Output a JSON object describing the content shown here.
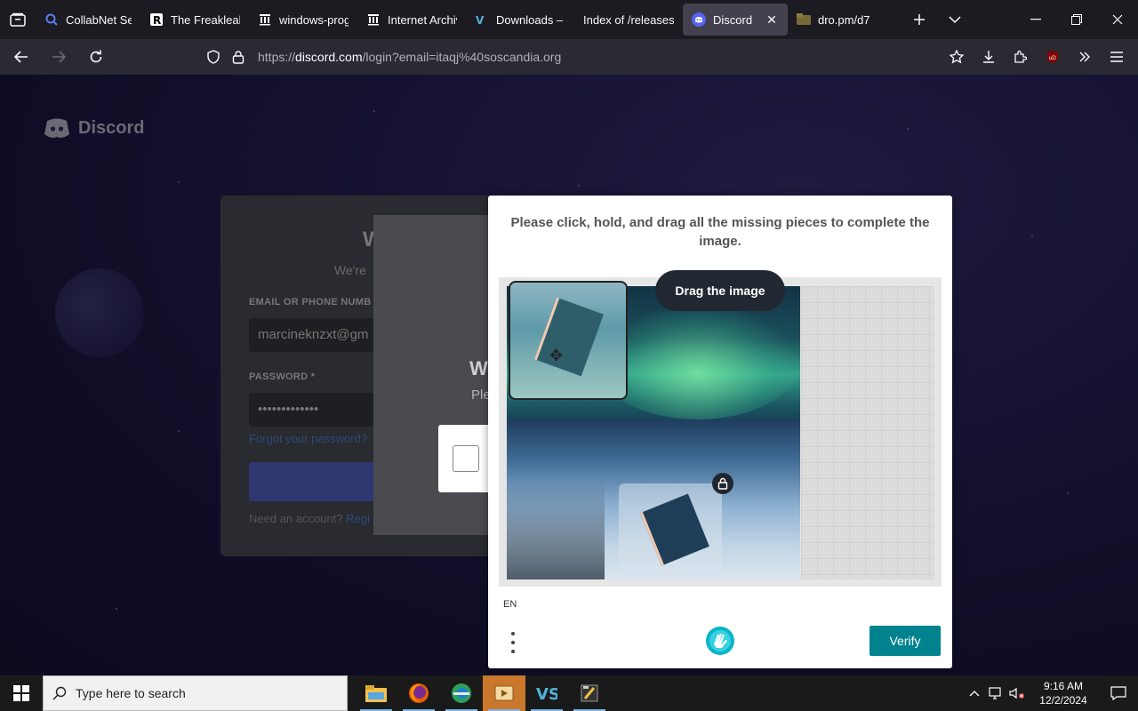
{
  "browser": {
    "tabs": [
      {
        "label": "CollabNet Sear",
        "icon": "search-icon"
      },
      {
        "label": "The Freakleak",
        "icon": "r-logo-icon"
      },
      {
        "label": "windows-prog",
        "icon": "archive-icon"
      },
      {
        "label": "Internet Archiv",
        "icon": "archive-icon"
      },
      {
        "label": "Downloads – (",
        "icon": "vs-icon"
      },
      {
        "label": "Index of /releases/",
        "icon": ""
      },
      {
        "label": "Discord",
        "icon": "discord-icon",
        "active": true
      },
      {
        "label": "dro.pm/d7",
        "icon": "folder-icon"
      }
    ],
    "url_prefix": "https://",
    "url_host": "discord.com",
    "url_path": "/login?email=itaqj%40soscandia.org"
  },
  "page": {
    "logo_text": "Discord",
    "login": {
      "heading": "W",
      "subheading": "We're",
      "email_label": "EMAIL OR PHONE NUMB",
      "email_value": "marcineknzxt@gm",
      "password_label": "PASSWORD *",
      "password_value": "•••••••••••••",
      "forgot_link": "Forgot your password?",
      "need_account": "Need an account?",
      "register_link": "Regi"
    },
    "overlay": {
      "heading": "W",
      "text": "Ple"
    }
  },
  "captcha": {
    "prompt": "Please click, hold, and drag all the missing pieces to complete the image.",
    "drag_tooltip": "Drag the image",
    "language": "EN",
    "verify_label": "Verify"
  },
  "taskbar": {
    "search_placeholder": "Type here to search",
    "time": "9:16 AM",
    "date": "12/2/2024",
    "apps": [
      "file-explorer-icon",
      "firefox-icon",
      "edge-icon",
      "media-player-icon",
      "vs-icon",
      "notepad-icon"
    ]
  },
  "colors": {
    "accent_verify": "#00838f",
    "active_tab": "#42414d",
    "page_bg": "#1f1b4a"
  }
}
